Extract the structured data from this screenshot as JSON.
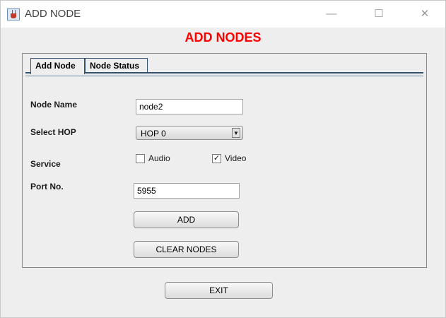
{
  "window": {
    "title": "ADD NODE",
    "controls": {
      "minimize": "—",
      "maximize": "☐",
      "close": "✕"
    }
  },
  "heading": {
    "text": "ADD NODES",
    "color": "#ff0000"
  },
  "tabs": [
    {
      "label": "Add Node",
      "active": true
    },
    {
      "label": "Node Status",
      "active": false
    }
  ],
  "form": {
    "node_name": {
      "label": "Node Name",
      "value": "node2"
    },
    "select_hop": {
      "label": "Select HOP",
      "value": "HOP 0"
    },
    "service": {
      "label": "Service",
      "options": [
        {
          "label": "Audio",
          "checked": false
        },
        {
          "label": "Video",
          "checked": true
        }
      ]
    },
    "port": {
      "label": "Port No.",
      "value": "5955"
    }
  },
  "buttons": {
    "add": "ADD",
    "clear": "CLEAR NODES",
    "exit": "EXIT"
  },
  "icons": {
    "app": "java-cup-icon",
    "dropdown": "▼",
    "check": "✓"
  }
}
